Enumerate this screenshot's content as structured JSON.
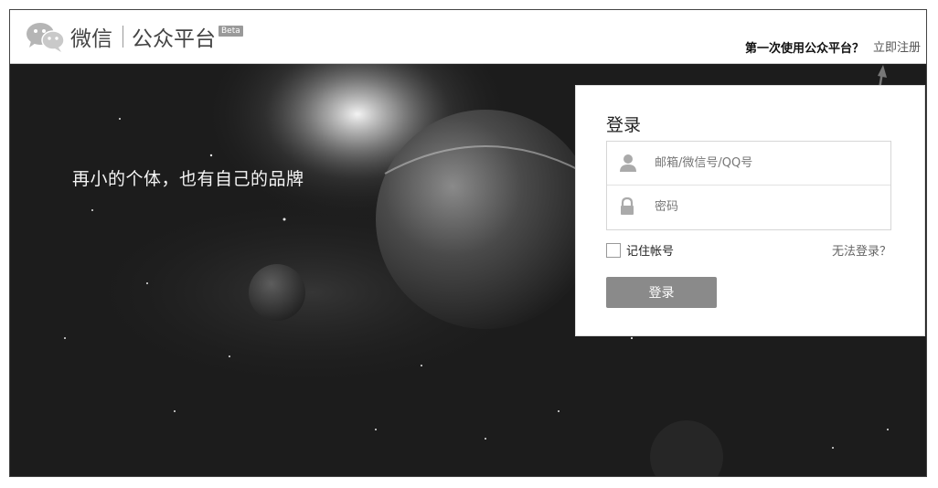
{
  "header": {
    "logo_icon": "wechat-bubbles-icon",
    "brand_name": "微信",
    "brand_sub": "公众平台",
    "beta": "Beta",
    "register_prompt": "第一次使用公众平台？",
    "register_link": "立即注册"
  },
  "hero": {
    "slogan": "再小的个体，也有自己的品牌"
  },
  "login": {
    "title": "登录",
    "username_placeholder": "邮箱/微信号/QQ号",
    "username_icon": "user-icon",
    "password_placeholder": "密码",
    "password_icon": "lock-icon",
    "remember_label": "记住帐号",
    "forgot_link": "无法登录？",
    "submit_label": "登录"
  },
  "colors": {
    "hero_bg": "#1b1b1b",
    "button_bg": "#8a8a8a",
    "panel_bg": "#ffffff"
  }
}
